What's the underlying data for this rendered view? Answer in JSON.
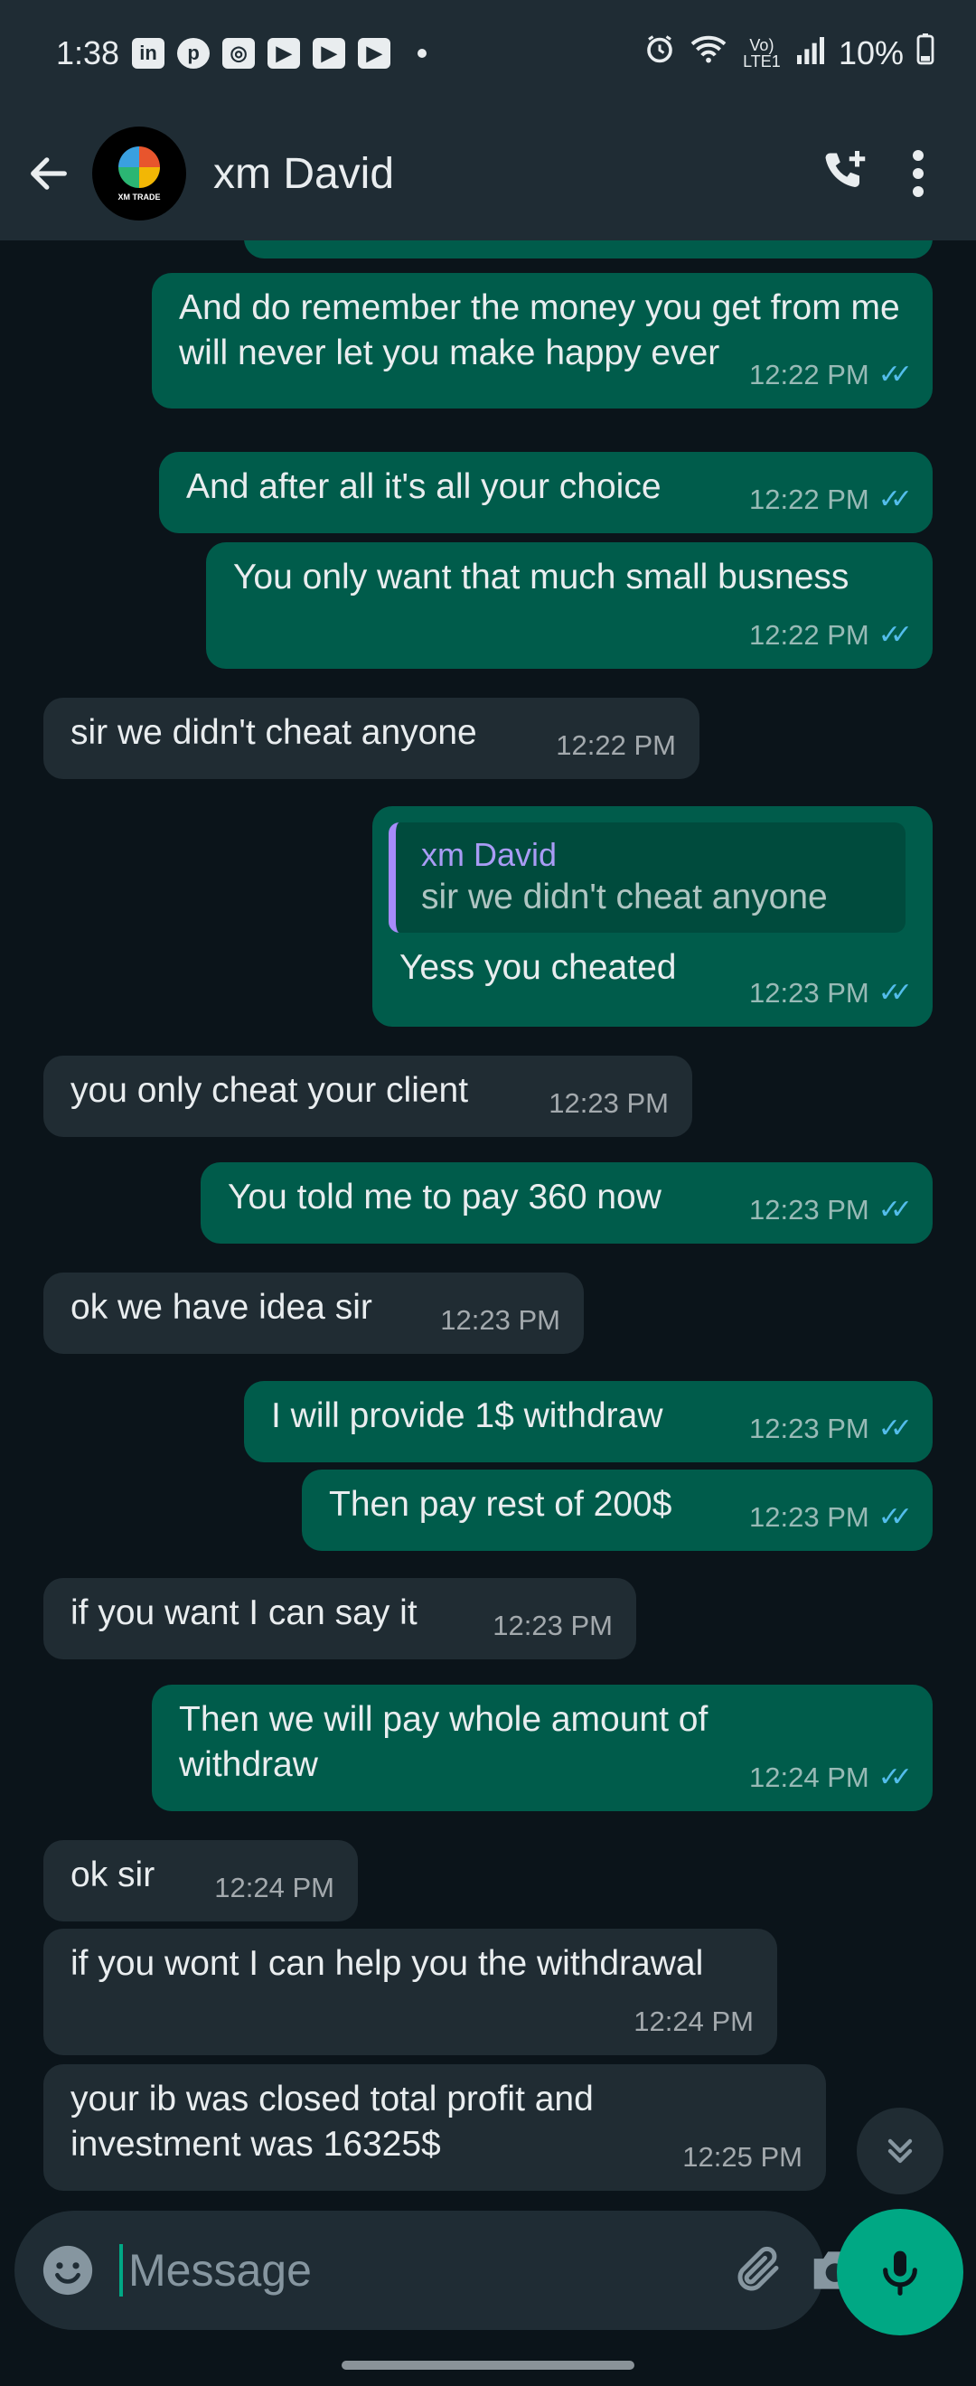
{
  "status_bar": {
    "time": "1:38",
    "network": "Vo) LTE1",
    "battery": "10%",
    "notification_icons": [
      "linkedin-icon",
      "pinterest-icon",
      "instagram-icon",
      "youtube-icon",
      "youtube-icon",
      "youtube-icon"
    ]
  },
  "header": {
    "contact_name": "xm David",
    "avatar_text": "XM TRADE"
  },
  "messages": [
    {
      "dir": "out",
      "text": "And do remember the money you get from me will never let you make happy ever",
      "time": "12:22 PM"
    },
    {
      "dir": "out",
      "text": "And after all it's all your choice",
      "time": "12:22 PM"
    },
    {
      "dir": "out",
      "text": "You only want that much small busness",
      "time": "12:22 PM"
    },
    {
      "dir": "in",
      "text": "sir we didn't cheat anyone",
      "time": "12:22 PM"
    },
    {
      "dir": "out",
      "quote_name": "xm David",
      "quote_text": "sir we didn't cheat anyone",
      "text": "Yess you cheated",
      "time": "12:23 PM"
    },
    {
      "dir": "in",
      "text": "you only cheat your client",
      "time": "12:23 PM"
    },
    {
      "dir": "out",
      "text": "You told me to pay 360 now",
      "time": "12:23 PM"
    },
    {
      "dir": "in",
      "text": "ok we have idea sir",
      "time": "12:23 PM"
    },
    {
      "dir": "out",
      "text": "I will provide 1$ withdraw",
      "time": "12:23 PM"
    },
    {
      "dir": "out",
      "text": "Then pay rest of 200$",
      "time": "12:23 PM"
    },
    {
      "dir": "in",
      "text": "if you want I can say it",
      "time": "12:23 PM"
    },
    {
      "dir": "out",
      "text": "Then we will pay whole amount of withdraw",
      "time": "12:24 PM"
    },
    {
      "dir": "in",
      "text": "ok sir",
      "time": "12:24 PM"
    },
    {
      "dir": "in",
      "text": "if you wont I can help you the withdrawal",
      "time": "12:24 PM"
    },
    {
      "dir": "in",
      "text": "your ib was closed total profit and investment was 16325$",
      "time": "12:25 PM"
    }
  ],
  "input": {
    "placeholder": "Message"
  },
  "colors": {
    "outgoing_bubble": "#005c4b",
    "incoming_bubble": "#202c33",
    "accent": "#00a884",
    "read_tick": "#53bdeb"
  }
}
